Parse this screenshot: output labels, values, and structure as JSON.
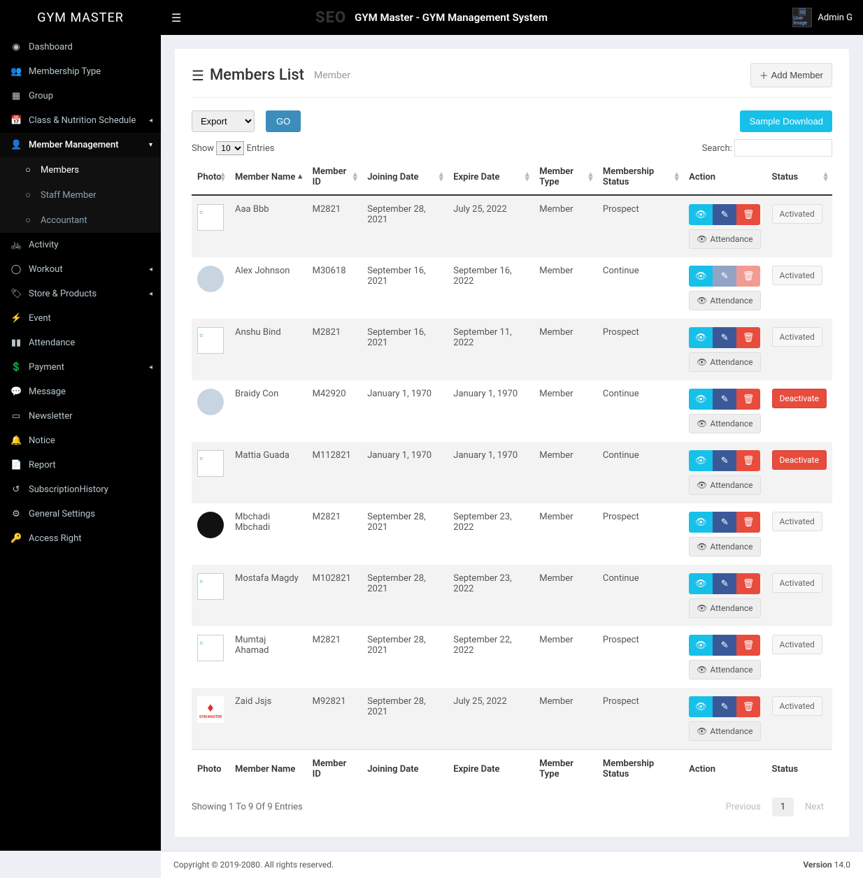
{
  "brand": "GYM MASTER",
  "topbar": {
    "title": "GYM Master - GYM Management System",
    "seo": "SEO",
    "user_name": "Admin G",
    "user_img_alt": "User Image"
  },
  "sidebar": {
    "items": [
      {
        "label": "Dashboard",
        "icon": "tachometer"
      },
      {
        "label": "Membership Type",
        "icon": "users"
      },
      {
        "label": "Group",
        "icon": "grid"
      },
      {
        "label": "Class & Nutrition Schedule",
        "icon": "calendar",
        "chev": true
      },
      {
        "label": "Member Management",
        "icon": "user",
        "chev_down": true,
        "active": true
      },
      {
        "label": "Members",
        "icon": "circle",
        "sub": true,
        "active_sub": true
      },
      {
        "label": "Staff Member",
        "icon": "circle",
        "sub": true
      },
      {
        "label": "Accountant",
        "icon": "circle",
        "sub": true
      },
      {
        "label": "Activity",
        "icon": "bike"
      },
      {
        "label": "Workout",
        "icon": "ring",
        "chev": true
      },
      {
        "label": "Store & Products",
        "icon": "tag",
        "chev": true
      },
      {
        "label": "Event",
        "icon": "bolt"
      },
      {
        "label": "Attendance",
        "icon": "bars-v"
      },
      {
        "label": "Payment",
        "icon": "money",
        "chev": true
      },
      {
        "label": "Message",
        "icon": "comment"
      },
      {
        "label": "Newsletter",
        "icon": "news"
      },
      {
        "label": "Notice",
        "icon": "bell"
      },
      {
        "label": "Report",
        "icon": "file"
      },
      {
        "label": "SubscriptionHistory",
        "icon": "history"
      },
      {
        "label": "General Settings",
        "icon": "sliders"
      },
      {
        "label": "Access Right",
        "icon": "key"
      }
    ]
  },
  "page": {
    "title": "Members List",
    "subtitle": "Member",
    "add_button": "Add Member",
    "export_label": "Export",
    "go_label": "GO",
    "sample_download": "Sample Download",
    "show_label": "Show",
    "entries_label": "Entries",
    "entries_value": "10",
    "search_label": "Search:"
  },
  "table": {
    "columns": [
      "Photo",
      "Member Name",
      "Member ID",
      "Joining Date",
      "Expire Date",
      "Member Type",
      "Membership Status",
      "Action",
      "Status"
    ],
    "attendance_label": "Attendance",
    "rows": [
      {
        "photo": "broken",
        "name": "Aaa Bbb",
        "mid": "M2821",
        "join": "September 28, 2021",
        "expire": "July 25, 2022",
        "type": "Member",
        "mstatus": "Prospect",
        "status": "Activated"
      },
      {
        "photo": "avatar",
        "name": "Alex Johnson",
        "mid": "M30618",
        "join": "September 16, 2021",
        "expire": "September 16, 2022",
        "type": "Member",
        "mstatus": "Continue",
        "status": "Activated",
        "faded": true
      },
      {
        "photo": "broken",
        "name": "Anshu Bind",
        "mid": "M2821",
        "join": "September 16, 2021",
        "expire": "September 11, 2022",
        "type": "Member",
        "mstatus": "Prospect",
        "status": "Activated"
      },
      {
        "photo": "avatar",
        "name": "Braidy Con",
        "mid": "M42920",
        "join": "January 1, 1970",
        "expire": "January 1, 1970",
        "type": "Member",
        "mstatus": "Continue",
        "status": "Deactivate"
      },
      {
        "photo": "broken",
        "name": "Mattia Guada",
        "mid": "M112821",
        "join": "January 1, 1970",
        "expire": "January 1, 1970",
        "type": "Member",
        "mstatus": "Continue",
        "status": "Deactivate"
      },
      {
        "photo": "dark",
        "name": "Mbchadi Mbchadi",
        "mid": "M2821",
        "join": "September 28, 2021",
        "expire": "September 23, 2022",
        "type": "Member",
        "mstatus": "Prospect",
        "status": "Activated"
      },
      {
        "photo": "broken",
        "name": "Mostafa Magdy",
        "mid": "M102821",
        "join": "September 28, 2021",
        "expire": "September 23, 2022",
        "type": "Member",
        "mstatus": "Continue",
        "status": "Activated"
      },
      {
        "photo": "broken",
        "name": "Mumtaj Ahamad",
        "mid": "M2821",
        "join": "September 28, 2021",
        "expire": "September 22, 2022",
        "type": "Member",
        "mstatus": "Prospect",
        "status": "Activated"
      },
      {
        "photo": "red-logo",
        "name": "Zaid Jsjs",
        "mid": "M92821",
        "join": "September 28, 2021",
        "expire": "July 25, 2022",
        "type": "Member",
        "mstatus": "Prospect",
        "status": "Activated"
      }
    ],
    "info": "Showing 1 To 9 Of 9 Entries",
    "prev": "Previous",
    "next": "Next",
    "page": "1"
  },
  "footer": {
    "copyright": "Copyright © 2019-2080. All rights reserved.",
    "version_label": "Version",
    "version": " 14.0"
  }
}
